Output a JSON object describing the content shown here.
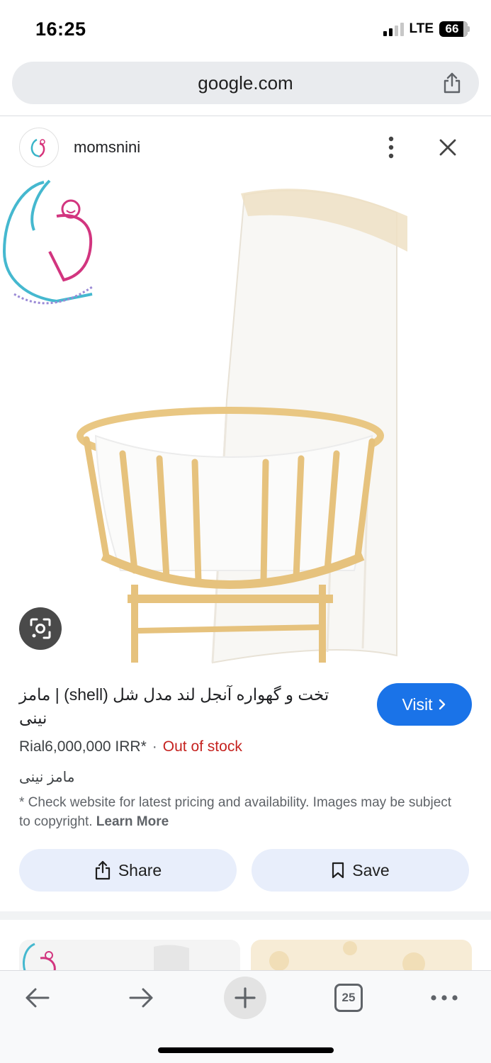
{
  "status_bar": {
    "time": "16:25",
    "network": "LTE",
    "battery": "66",
    "icons": [
      "signal-icon",
      "battery-icon"
    ]
  },
  "url_bar": {
    "url": "google.com",
    "share_icon": "share-icon"
  },
  "source": {
    "name": "momsnini",
    "icons": [
      "more-vert-icon",
      "close-icon"
    ]
  },
  "image": {
    "alt": "",
    "lens_icon": "lens-icon"
  },
  "product": {
    "title": "تخت و گهواره آنجل لند مدل شل (shell) | مامز نینی",
    "visit_label": "Visit",
    "price": "Rial6,000,000 IRR*",
    "separator": "·",
    "stock_status": "Out of stock",
    "seller": "مامز نینی",
    "disclaimer": "* Check website for latest pricing and availability. Images may be subject to copyright.",
    "learn_more": "Learn More"
  },
  "actions": {
    "share_label": "Share",
    "save_label": "Save"
  },
  "toolbar": {
    "tabs_count": "25",
    "icons": [
      "back-icon",
      "forward-icon",
      "new-tab-icon",
      "tabs-icon",
      "more-horiz-icon"
    ]
  },
  "colors": {
    "accent": "#1a73e8",
    "out_of_stock": "#c5221f",
    "action_bg": "#e8eefb"
  }
}
